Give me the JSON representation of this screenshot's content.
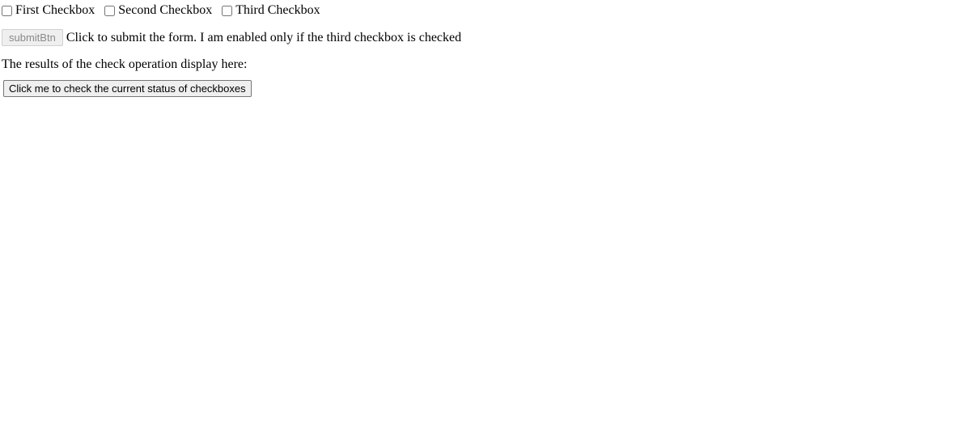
{
  "checkboxes": [
    {
      "label": "First Checkbox"
    },
    {
      "label": "Second Checkbox"
    },
    {
      "label": "Third Checkbox"
    }
  ],
  "submit": {
    "button_label": "submitBtn",
    "hint": "Click to submit the form. I am enabled only if the third checkbox is checked"
  },
  "results_label": "The results of the check operation display here:",
  "check_button_label": "Click me to check the current status of checkboxes"
}
